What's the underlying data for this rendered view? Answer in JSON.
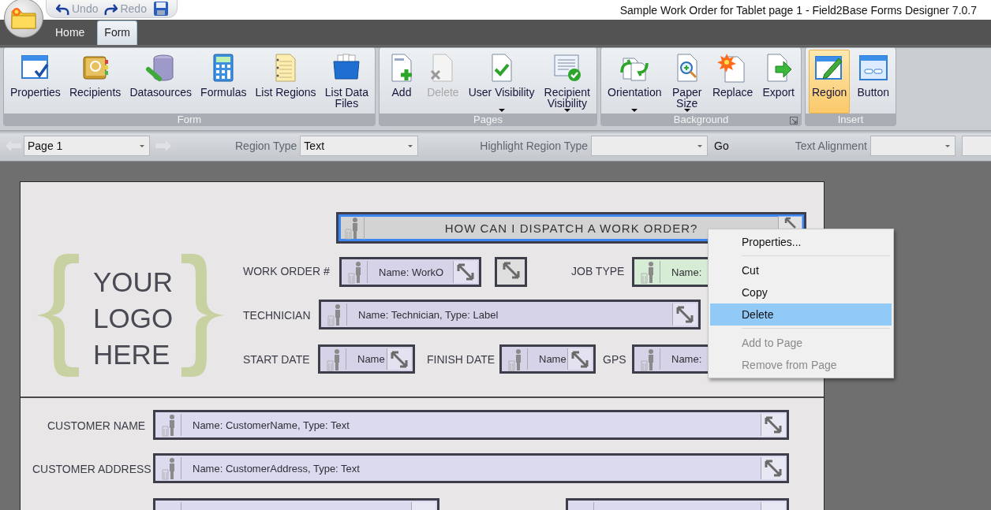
{
  "window": {
    "title": "Sample Work Order for Tablet page 1 - Field2Base Forms Designer 7.0.7"
  },
  "quick_access": [
    {
      "kind": "undo",
      "label": "Undo",
      "disabled": true
    },
    {
      "kind": "redo",
      "label": "Redo",
      "disabled": true
    },
    {
      "kind": "save"
    }
  ],
  "ribbon_tabs": [
    {
      "label": "Home",
      "selected": false
    },
    {
      "label": "Form",
      "selected": true
    }
  ],
  "ribbon_groups": [
    {
      "label": "Form",
      "launcher": false,
      "buttons": [
        {
          "kind": "properties",
          "label": "Properties",
          "disabled": false,
          "selected": false,
          "dropdown": false
        },
        {
          "kind": "recipients",
          "label": "Recipients",
          "disabled": false,
          "selected": false,
          "dropdown": false
        },
        {
          "kind": "datasources",
          "label": "Datasources",
          "disabled": false,
          "selected": false,
          "dropdown": false
        },
        {
          "kind": "formulas",
          "label": "Formulas",
          "disabled": false,
          "selected": false,
          "dropdown": false
        },
        {
          "kind": "list-regions",
          "label": "List Regions",
          "disabled": false,
          "selected": false,
          "dropdown": false
        },
        {
          "kind": "list-data-files",
          "label": "List Data\nFiles",
          "disabled": false,
          "selected": false,
          "dropdown": false
        }
      ]
    },
    {
      "label": "Pages",
      "launcher": false,
      "buttons": [
        {
          "kind": "add",
          "label": "Add",
          "disabled": false,
          "selected": false,
          "dropdown": false
        },
        {
          "kind": "delete",
          "label": "Delete",
          "disabled": true,
          "selected": false,
          "dropdown": false
        },
        {
          "kind": "user-visibility",
          "label": "User Visibility",
          "disabled": false,
          "selected": false,
          "dropdown": true
        },
        {
          "kind": "recipient-visibility",
          "label": "Recipient\nVisibility",
          "disabled": false,
          "selected": false,
          "dropdown": true
        }
      ]
    },
    {
      "label": "Background",
      "launcher": true,
      "buttons": [
        {
          "kind": "orientation",
          "label": "Orientation",
          "disabled": false,
          "selected": false,
          "dropdown": true
        },
        {
          "kind": "paper-size",
          "label": "Paper\nSize",
          "disabled": false,
          "selected": false,
          "dropdown": true
        },
        {
          "kind": "replace",
          "label": "Replace",
          "disabled": false,
          "selected": false,
          "dropdown": false
        },
        {
          "kind": "export",
          "label": "Export",
          "disabled": false,
          "selected": false,
          "dropdown": false
        }
      ]
    },
    {
      "label": "Insert",
      "launcher": false,
      "buttons": [
        {
          "kind": "region",
          "label": "Region",
          "disabled": false,
          "selected": true,
          "dropdown": false
        },
        {
          "kind": "button",
          "label": "Button",
          "disabled": false,
          "selected": false,
          "dropdown": false
        }
      ]
    }
  ],
  "toolbar": [
    {
      "kind": "back",
      "disabled": true
    },
    {
      "kind": "combo",
      "value": "Page 1"
    },
    {
      "kind": "forward",
      "disabled": true
    },
    {
      "kind": "label",
      "label": "Region Type"
    },
    {
      "kind": "combo",
      "value": "Text"
    },
    {
      "kind": "label",
      "label": "Highlight Region Type"
    },
    {
      "kind": "combo"
    },
    {
      "kind": "button",
      "label": "Go"
    },
    {
      "kind": "label",
      "label": "Text Alignment"
    },
    {
      "kind": "combo"
    },
    {
      "kind": "combo"
    }
  ],
  "form": {
    "logo_text": "YOUR LOGO HERE",
    "elements": [
      {
        "kind": "header",
        "text": "HOW CAN I DISPATCH A WORK ORDER?",
        "color": "#d3d3d3",
        "selected": true
      },
      {
        "kind": "label",
        "text": "WORK ORDER #"
      },
      {
        "kind": "field",
        "text": "Name: WorkO",
        "color": "#d6d3e8",
        "selected": false
      },
      {
        "kind": "handle",
        "color": "#dedede",
        "selected": false
      },
      {
        "kind": "label",
        "text": "JOB TYPE"
      },
      {
        "kind": "covered-field",
        "text": "Name:",
        "color": "#d7ecd4",
        "selected": false
      },
      {
        "kind": "label",
        "text": "TECHNICIAN"
      },
      {
        "kind": "field",
        "text": "Name: Technician, Type: Label",
        "color": "#d6d3e8",
        "selected": false
      },
      {
        "kind": "label",
        "text": "START DATE"
      },
      {
        "kind": "field",
        "text": "Name",
        "color": "#d6d3e8",
        "selected": false
      },
      {
        "kind": "label",
        "text": "FINISH DATE"
      },
      {
        "kind": "field",
        "text": "Name",
        "color": "#d6d3e8",
        "selected": false
      },
      {
        "kind": "label",
        "text": "GPS"
      },
      {
        "kind": "covered-field",
        "text": "Name:",
        "color": "#d6d3e8",
        "selected": false
      },
      {
        "kind": "label",
        "text": "CUSTOMER NAME"
      },
      {
        "kind": "field",
        "text": "Name: CustomerName, Type: Text",
        "color": "#dcdaef",
        "selected": false
      },
      {
        "kind": "label",
        "text": "CUSTOMER ADDRESS"
      },
      {
        "kind": "field",
        "text": "Name: CustomerAddress, Type: Text",
        "color": "#dcdaef",
        "selected": false
      },
      {
        "kind": "field",
        "color": "#dcdaef",
        "selected": false
      },
      {
        "kind": "field",
        "color": "#dcdaef",
        "selected": false
      }
    ]
  },
  "context_menu": [
    {
      "kind": "item",
      "label": "Properties...",
      "selected": false,
      "disabled": false
    },
    {
      "kind": "separator"
    },
    {
      "kind": "item",
      "label": "Cut",
      "selected": false,
      "disabled": false
    },
    {
      "kind": "item",
      "label": "Copy",
      "selected": false,
      "disabled": false
    },
    {
      "kind": "item",
      "label": "Delete",
      "selected": true,
      "disabled": false
    },
    {
      "kind": "separator"
    },
    {
      "kind": "item",
      "label": "Add to Page",
      "selected": false,
      "disabled": true
    },
    {
      "kind": "item",
      "label": "Remove from Page",
      "selected": false,
      "disabled": true
    }
  ]
}
